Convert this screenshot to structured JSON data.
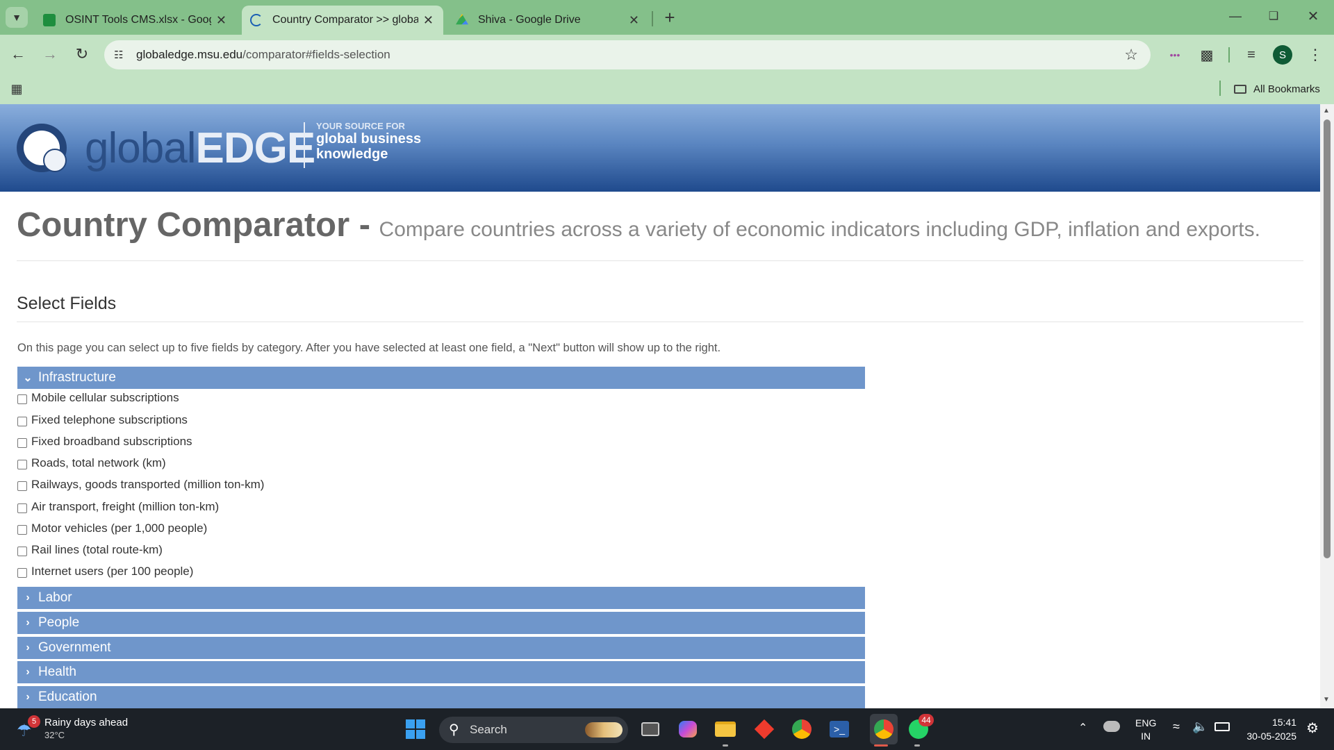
{
  "browser": {
    "tabs": [
      {
        "title": "OSINT Tools CMS.xlsx - Google",
        "active": false
      },
      {
        "title": "Country Comparator >> globalE",
        "active": true
      },
      {
        "title": "Shiva - Google Drive",
        "active": false
      }
    ],
    "url_host": "globaledge.msu.edu",
    "url_path": "/comparator#fields-selection",
    "profile_initial": "S",
    "bookmarks_label": "All Bookmarks"
  },
  "site": {
    "logo_global": "global",
    "logo_edge": "EDGE",
    "tagline_small": "YOUR SOURCE FOR",
    "tagline_line1": "global business",
    "tagline_line2": "knowledge"
  },
  "page": {
    "title": "Country Comparator -",
    "subtitle": "Compare countries across a variety of economic indicators including GDP, inflation and exports.",
    "section_title": "Select Fields",
    "instructions": "On this page you can select up to five fields by category. After you have selected at least one field, a \"Next\" button will show up to the right."
  },
  "categories": [
    {
      "name": "Infrastructure",
      "expanded": true,
      "fields": [
        "Mobile cellular subscriptions",
        "Fixed telephone subscriptions",
        "Fixed broadband subscriptions",
        "Roads, total network (km)",
        "Railways, goods transported (million ton-km)",
        "Air transport, freight (million ton-km)",
        "Motor vehicles (per 1,000 people)",
        "Rail lines (total route-km)",
        "Internet users (per 100 people)"
      ]
    },
    {
      "name": "Labor",
      "expanded": false
    },
    {
      "name": "People",
      "expanded": false
    },
    {
      "name": "Government",
      "expanded": false
    },
    {
      "name": "Health",
      "expanded": false
    },
    {
      "name": "Education",
      "expanded": false
    }
  ],
  "taskbar": {
    "weather_title": "Rainy days ahead",
    "weather_temp": "32°C",
    "weather_badge": "5",
    "search_label": "Search",
    "whatsapp_badge": "44",
    "lang_line1": "ENG",
    "lang_line2": "IN",
    "time": "15:41",
    "date": "30-05-2025"
  }
}
